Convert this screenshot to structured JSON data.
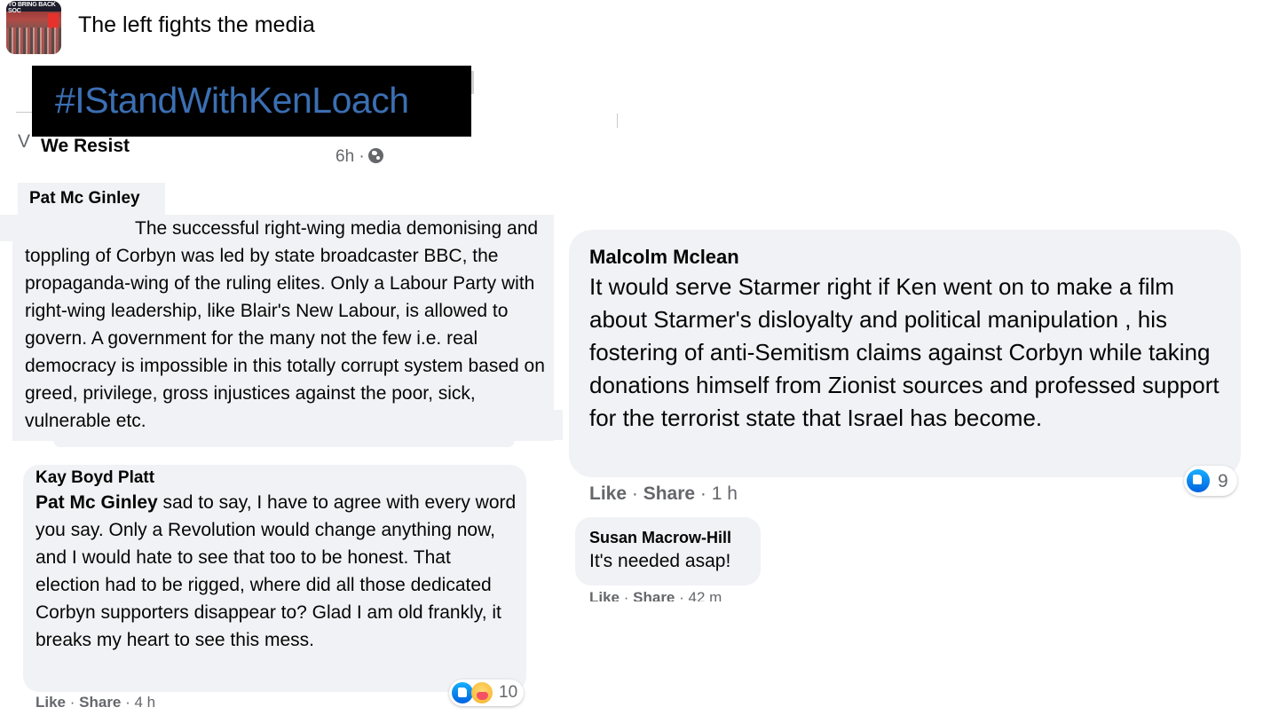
{
  "group": {
    "title": "The left fights the media",
    "avatar_text": "TO BRING BACK SOC"
  },
  "post": {
    "hashtag": "#IStandWithKenLoach",
    "author": "We Resist",
    "partial_char": "V",
    "time": "6h ·"
  },
  "comments": [
    {
      "author": "Pat Mc Ginley",
      "text": "The successful right-wing media demonising and toppling of Corbyn was led by state broadcaster BBC, the propaganda-wing of the ruling elites. Only a Labour Party with right-wing leadership, like Blair's New Labour, is allowed to govern. A government for the many not the few i.e. real democracy is impossible in this totally corrupt system based on greed, privilege, gross injustices against the poor, sick, vulnerable etc."
    },
    {
      "author": "Kay Boyd Platt",
      "mention": "Pat Mc Ginley",
      "text": " sad to say, I have to agree with every word you say. Only a Revolution would change anything now, and I would hate to see that too to be honest. That election had to be rigged, where did all those dedicated Corbyn supporters disappear to? Glad I am old frankly, it breaks my heart to see this mess.",
      "reactions": "10",
      "like": "Like",
      "share": "Share",
      "time": "4 h"
    },
    {
      "author": "Malcolm Mclean",
      "text": "It would serve Starmer right if Ken went on to make a film about Starmer's disloyalty and political manipulation , his fostering of anti-Semitism claims against Corbyn while taking donations himself from Zionist sources and professed support for the terrorist state that Israel has become.",
      "reactions": "9",
      "like": "Like",
      "share": "Share",
      "time": "1 h"
    },
    {
      "author": "Susan Macrow-Hill",
      "text": "It's needed asap!",
      "like": "Like",
      "share": "Share",
      "time": "42 m"
    }
  ],
  "colors": {
    "bubble": "#f0f2f5",
    "meta": "#65676b",
    "like_blue": "#1877f2"
  }
}
